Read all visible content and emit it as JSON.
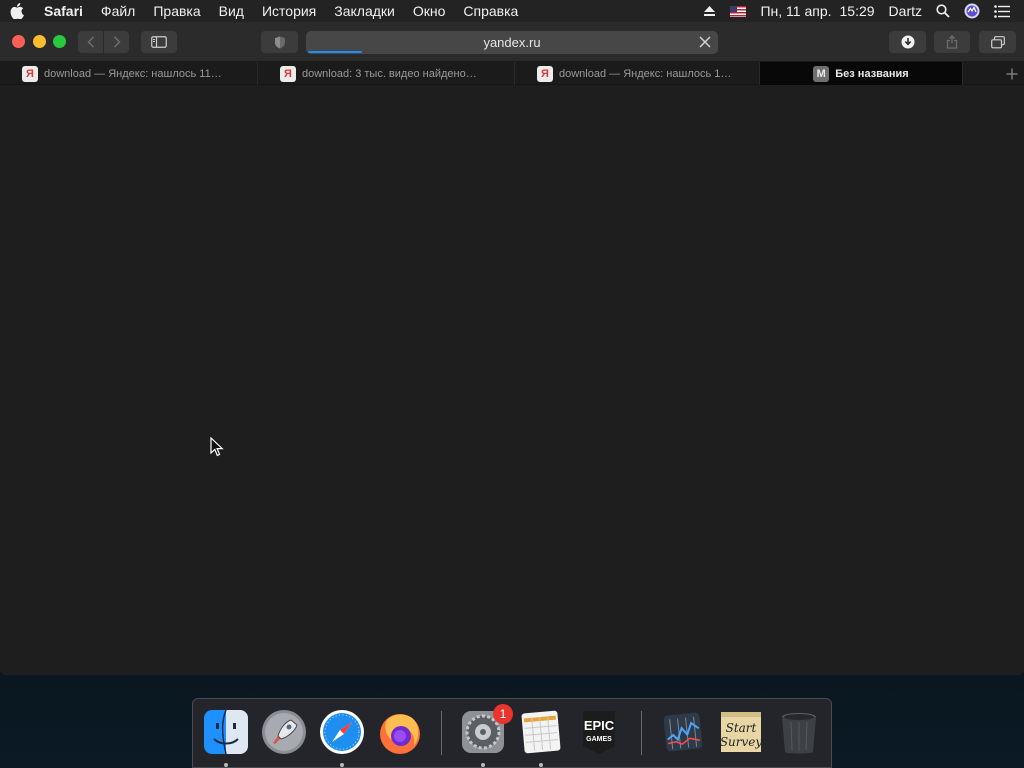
{
  "menubar": {
    "app_name": "Safari",
    "items": [
      "Файл",
      "Правка",
      "Вид",
      "История",
      "Закладки",
      "Окно",
      "Справка"
    ],
    "date": "Пн, 11 апр.",
    "time": "15:29",
    "user": "Dartz"
  },
  "toolbar": {
    "url": "yandex.ru",
    "load_progress": 0.13
  },
  "tabs": [
    {
      "favicon": "Я",
      "title": "download — Яндекс: нашлось 11…"
    },
    {
      "favicon": "Я",
      "title": "download: 3 тыс. видео найдено…"
    },
    {
      "favicon": "Я",
      "title": "download — Яндекс: нашлось 1…"
    },
    {
      "favicon": "M",
      "title": "Без названия"
    }
  ],
  "dock": {
    "apps": [
      "Finder",
      "Launchpad",
      "Safari",
      "Firefox",
      "System Preferences",
      "Numbers",
      "Epic Games",
      "Stocks",
      "Start Survey",
      "Trash"
    ],
    "system_preferences_badge": "1",
    "epic_label_top": "EPIC",
    "epic_label_bottom": "GAMES",
    "survey_label_1": "Start",
    "survey_label_2": "Survey"
  },
  "colors": {
    "menubar": "#232323",
    "window_bg": "#1e1e1e",
    "accent_progress": "#1f8ef1",
    "close": "#fe5f57",
    "minimize": "#febc2e",
    "maximize": "#28c840"
  }
}
